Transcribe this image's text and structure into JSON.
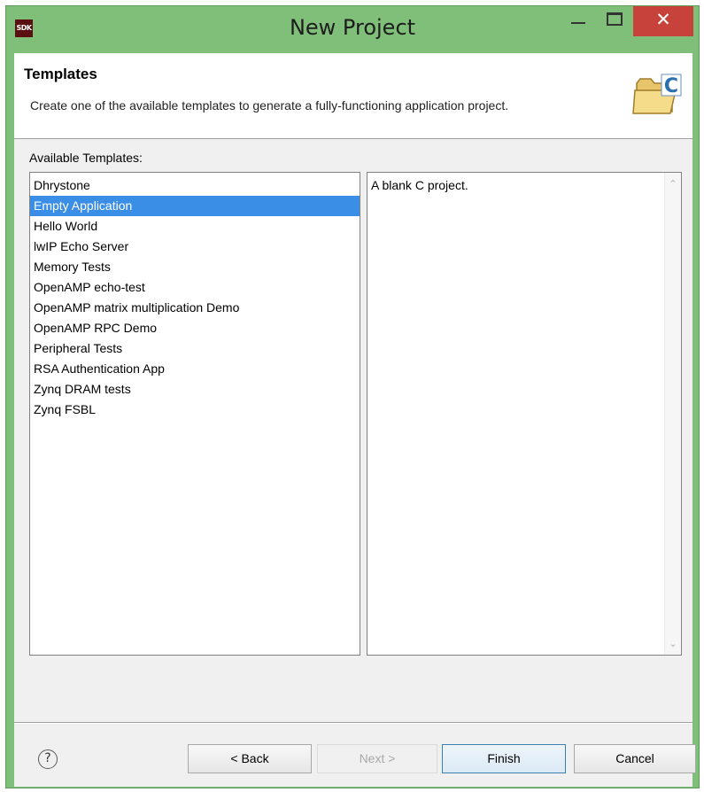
{
  "window": {
    "app_icon_text": "SDK",
    "title": "New Project",
    "minimize_icon": "minimize-icon",
    "maximize_icon": "maximize-icon",
    "close_glyph": "✕"
  },
  "banner": {
    "title": "Templates",
    "description": "Create one of the available templates to generate a fully-functioning application project.",
    "icon": "c-project-folder-icon"
  },
  "templates": {
    "label": "Available Templates:",
    "items": [
      "Dhrystone",
      "Empty Application",
      "Hello World",
      "lwIP Echo Server",
      "Memory Tests",
      "OpenAMP echo-test",
      "OpenAMP matrix multiplication Demo",
      "OpenAMP RPC Demo",
      "Peripheral Tests",
      "RSA Authentication App",
      "Zynq DRAM tests",
      "Zynq FSBL"
    ],
    "selected": "Empty Application"
  },
  "description": {
    "text": "A blank C project."
  },
  "buttons": {
    "help": "?",
    "back": "< Back",
    "next": "Next >",
    "finish": "Finish",
    "cancel": "Cancel"
  },
  "colors": {
    "title_bar": "#7fbf79",
    "close_button": "#c7423a",
    "selection": "#3a8ee6"
  }
}
